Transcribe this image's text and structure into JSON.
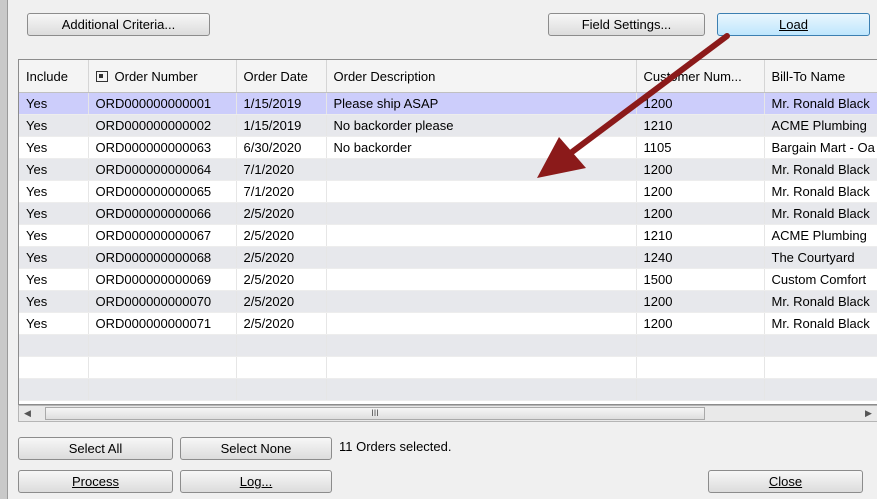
{
  "toolbar": {
    "additional_criteria_label": "Additional Criteria...",
    "field_settings_label": "Field Settings...",
    "load_label": "Load"
  },
  "grid": {
    "columns": [
      "Include",
      "Order Number",
      "Order Date",
      "Order Description",
      "Customer Num...",
      "Bill-To Name"
    ],
    "rows": [
      {
        "include": "Yes",
        "order_number": "ORD000000000001",
        "order_date": "1/15/2019",
        "description": "Please ship ASAP",
        "customer": "1200",
        "bill_to": "Mr. Ronald Black"
      },
      {
        "include": "Yes",
        "order_number": "ORD000000000002",
        "order_date": "1/15/2019",
        "description": "No backorder please",
        "customer": "1210",
        "bill_to": "ACME Plumbing"
      },
      {
        "include": "Yes",
        "order_number": "ORD000000000063",
        "order_date": "6/30/2020",
        "description": "No backorder",
        "customer": "1105",
        "bill_to": "Bargain Mart - Oa"
      },
      {
        "include": "Yes",
        "order_number": "ORD000000000064",
        "order_date": "7/1/2020",
        "description": "",
        "customer": "1200",
        "bill_to": "Mr. Ronald Black"
      },
      {
        "include": "Yes",
        "order_number": "ORD000000000065",
        "order_date": "7/1/2020",
        "description": "",
        "customer": "1200",
        "bill_to": "Mr. Ronald Black"
      },
      {
        "include": "Yes",
        "order_number": "ORD000000000066",
        "order_date": "2/5/2020",
        "description": "",
        "customer": "1200",
        "bill_to": "Mr. Ronald Black"
      },
      {
        "include": "Yes",
        "order_number": "ORD000000000067",
        "order_date": "2/5/2020",
        "description": "",
        "customer": "1210",
        "bill_to": "ACME Plumbing"
      },
      {
        "include": "Yes",
        "order_number": "ORD000000000068",
        "order_date": "2/5/2020",
        "description": "",
        "customer": "1240",
        "bill_to": "The Courtyard"
      },
      {
        "include": "Yes",
        "order_number": "ORD000000000069",
        "order_date": "2/5/2020",
        "description": "",
        "customer": "1500",
        "bill_to": "Custom Comfort"
      },
      {
        "include": "Yes",
        "order_number": "ORD000000000070",
        "order_date": "2/5/2020",
        "description": "",
        "customer": "1200",
        "bill_to": "Mr. Ronald Black"
      },
      {
        "include": "Yes",
        "order_number": "ORD000000000071",
        "order_date": "2/5/2020",
        "description": "",
        "customer": "1200",
        "bill_to": "Mr. Ronald Black"
      }
    ],
    "scroll_thumb_glyph": "III"
  },
  "footer": {
    "select_all_label": "Select All",
    "select_none_label": "Select None",
    "status_text": "11 Orders selected.",
    "process_label": "Process",
    "log_label": "Log...",
    "close_label": "Close"
  },
  "colors": {
    "selected_row": "#cccdfb",
    "alt_row": "#e7e8ec",
    "annotation_arrow": "#8b1a1a"
  }
}
